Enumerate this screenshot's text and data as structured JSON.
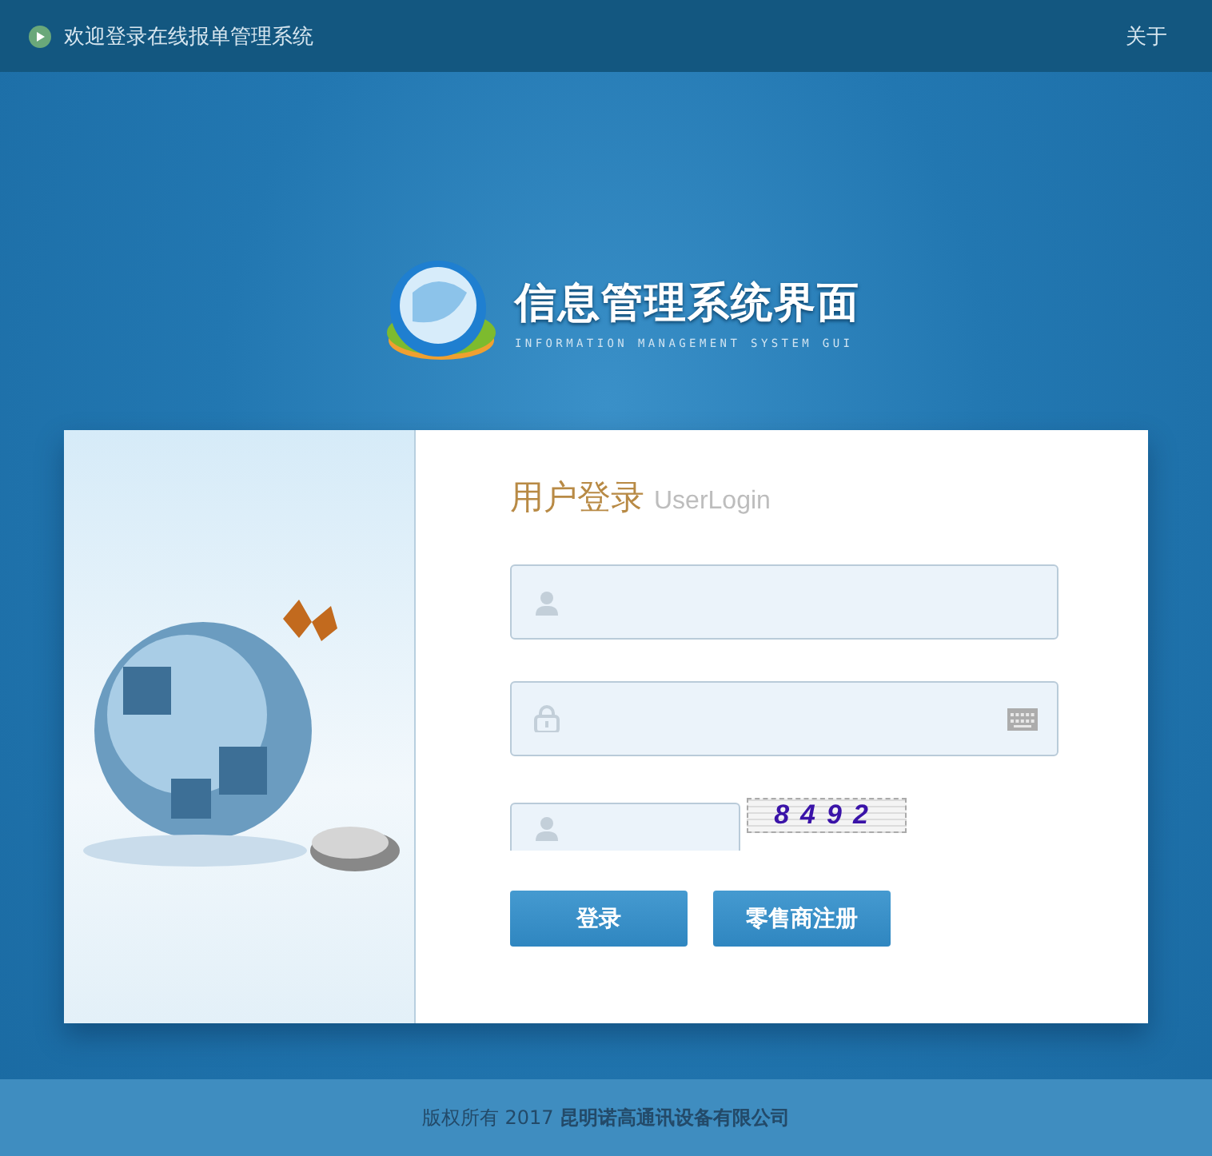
{
  "topbar": {
    "title": "欢迎登录在线报单管理系统",
    "about": "关于"
  },
  "logo": {
    "title": "信息管理系统界面",
    "subtitle": "INFORMATION MANAGEMENT SYSTEM GUI"
  },
  "login": {
    "heading": "用户登录",
    "heading_en": "UserLogin",
    "fields": [
      {
        "kind": "user"
      },
      {
        "kind": "password"
      },
      {
        "kind": "captcha"
      }
    ],
    "captcha": "8492",
    "buttons": [
      "登录",
      "零售商注册"
    ]
  },
  "footer": "版权所有 2017 **昆明诺高通讯设备有限公司**"
}
